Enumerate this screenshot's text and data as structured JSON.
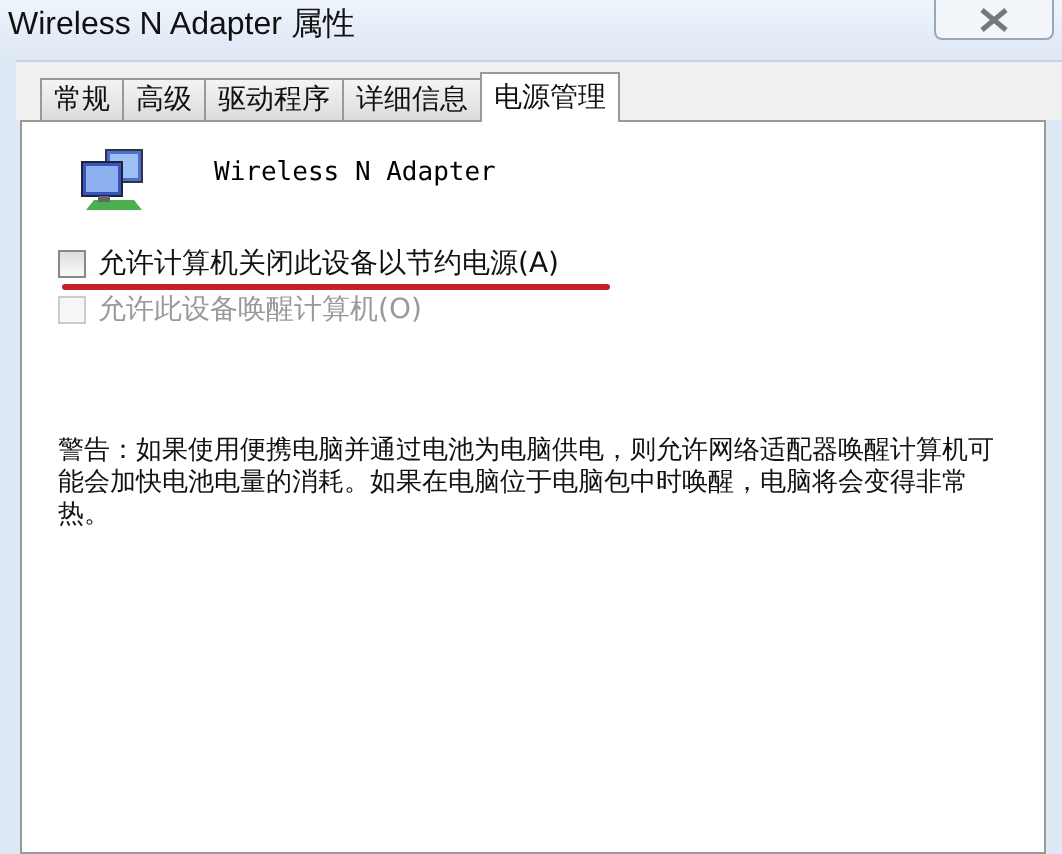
{
  "window": {
    "title": "Wireless N Adapter 属性"
  },
  "tabs": [
    {
      "label": "常规",
      "selected": false
    },
    {
      "label": "高级",
      "selected": false
    },
    {
      "label": "驱动程序",
      "selected": false
    },
    {
      "label": "详细信息",
      "selected": false
    },
    {
      "label": "电源管理",
      "selected": true
    }
  ],
  "device": {
    "name": "Wireless N Adapter"
  },
  "options": [
    {
      "label": "允许计算机关闭此设备以节约电源(A)",
      "checked": false,
      "disabled": false,
      "highlighted": true
    },
    {
      "label": "允许此设备唤醒计算机(O)",
      "checked": false,
      "disabled": true,
      "highlighted": false
    }
  ],
  "warning": "警告：如果使用便携电脑并通过电池为电脑供电，则允许网络适配器唤醒计算机可能会加快电池电量的消耗。如果在电脑位于电脑包中时唤醒，电脑将会变得非常热。"
}
